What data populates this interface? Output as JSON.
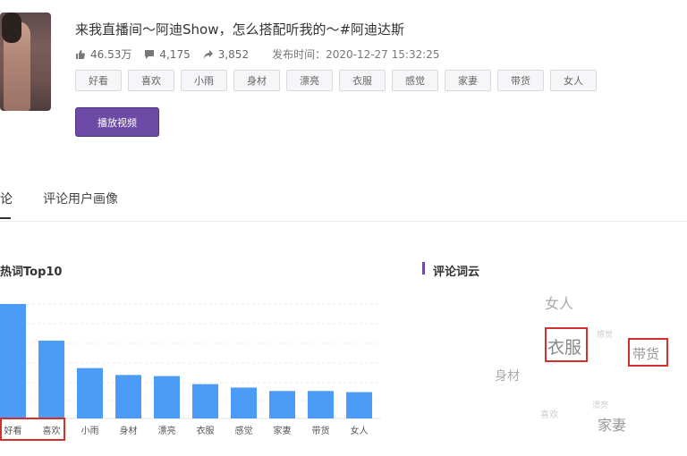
{
  "video": {
    "title": "来我直播间～阿迪Show，怎么搭配听我的～#阿迪达斯",
    "stats": {
      "likes": "46.53万",
      "comments": "4,175",
      "shares": "3,852",
      "publish_time": "发布时间：2020-12-27 15:32:25"
    },
    "tags": [
      "好看",
      "喜欢",
      "小雨",
      "身材",
      "漂亮",
      "衣服",
      "感觉",
      "家妻",
      "带货",
      "女人"
    ],
    "play_button": "播放视频"
  },
  "tabs": {
    "first_partial": "论",
    "second": "评论用户画像"
  },
  "hotwords": {
    "title": "热词Top10"
  },
  "wordcloud": {
    "title": "评论词云",
    "words": [
      {
        "text": "女人",
        "color": "#aaaaaa"
      },
      {
        "text": "衣服",
        "color": "#888888"
      },
      {
        "text": "感觉",
        "color": "#cccccc"
      },
      {
        "text": "带货",
        "color": "#999999"
      },
      {
        "text": "身材",
        "color": "#aaaaaa"
      },
      {
        "text": "漂亮",
        "color": "#cccccc"
      },
      {
        "text": "喜欢",
        "color": "#cccccc"
      },
      {
        "text": "家妻",
        "color": "#999999"
      }
    ]
  },
  "chart_data": {
    "type": "bar",
    "title": "热词Top10",
    "categories": [
      "好看",
      "喜欢",
      "小雨",
      "身材",
      "漂亮",
      "衣服",
      "感觉",
      "家妻",
      "带货",
      "女人"
    ],
    "values": [
      100,
      68,
      44,
      38,
      37,
      30,
      27,
      24,
      24,
      23
    ],
    "grid": true,
    "bar_color": "#4c9cf7"
  },
  "colors": {
    "accent": "#6c4aa6",
    "highlight": "#d32f2f",
    "bar": "#4c9cf7"
  }
}
